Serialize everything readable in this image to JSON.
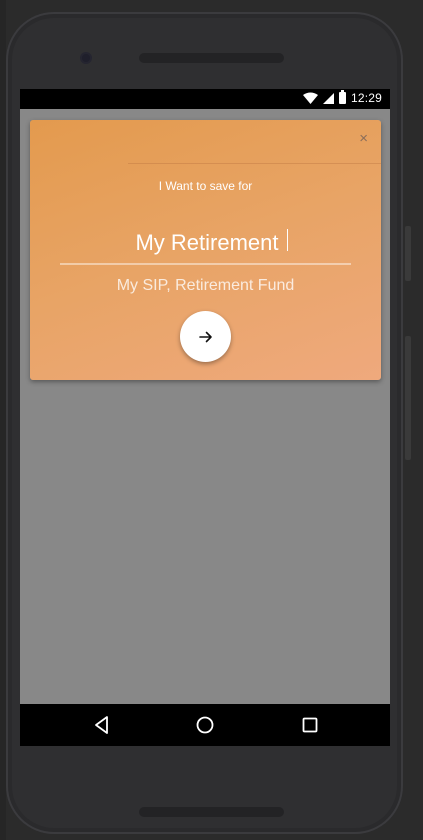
{
  "status_bar": {
    "time": "12:29",
    "icons": [
      "wifi-icon",
      "signal-icon",
      "battery-icon"
    ]
  },
  "dialog": {
    "close_symbol": "×",
    "label": "I Want to save for",
    "goal_value": "My Retirement",
    "hint": "My SIP, Retirement Fund",
    "next_icon": "arrow-right-icon"
  },
  "nav_bar": {
    "buttons": [
      "back-icon",
      "home-icon",
      "recents-icon"
    ]
  },
  "colors": {
    "card_gradient_start": "#e39a4e",
    "card_gradient_end": "#efa97d",
    "screen_background": "#888888"
  }
}
